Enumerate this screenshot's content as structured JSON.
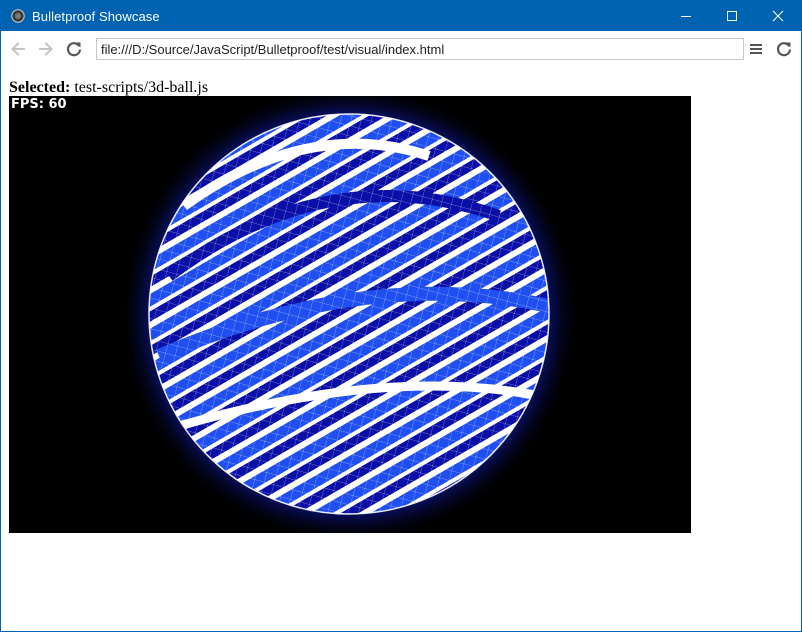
{
  "window": {
    "title": "Bulletproof Showcase",
    "app_icon": "app-logo-icon",
    "controls": [
      "minimize-icon",
      "maximize-icon",
      "close-icon"
    ],
    "accent_color": "#0063b1"
  },
  "toolbar": {
    "back_icon": "back-arrow-icon",
    "forward_icon": "forward-arrow-icon",
    "reload_icon": "reload-icon",
    "address": "file:///D:/Source/JavaScript/Bulletproof/test/visual/index.html",
    "menu_icon": "hamburger-menu-icon",
    "refresh_icon": "refresh-icon"
  },
  "page": {
    "selected_label": "Selected:",
    "selected_value": "test-scripts/3d-ball.js",
    "fps_label": "FPS: 60",
    "canvas_background": "#000000",
    "ball_colors": {
      "white": "#ffffff",
      "bright_blue": "#1f4ff0",
      "dark_blue": "#0a0fa8"
    }
  }
}
